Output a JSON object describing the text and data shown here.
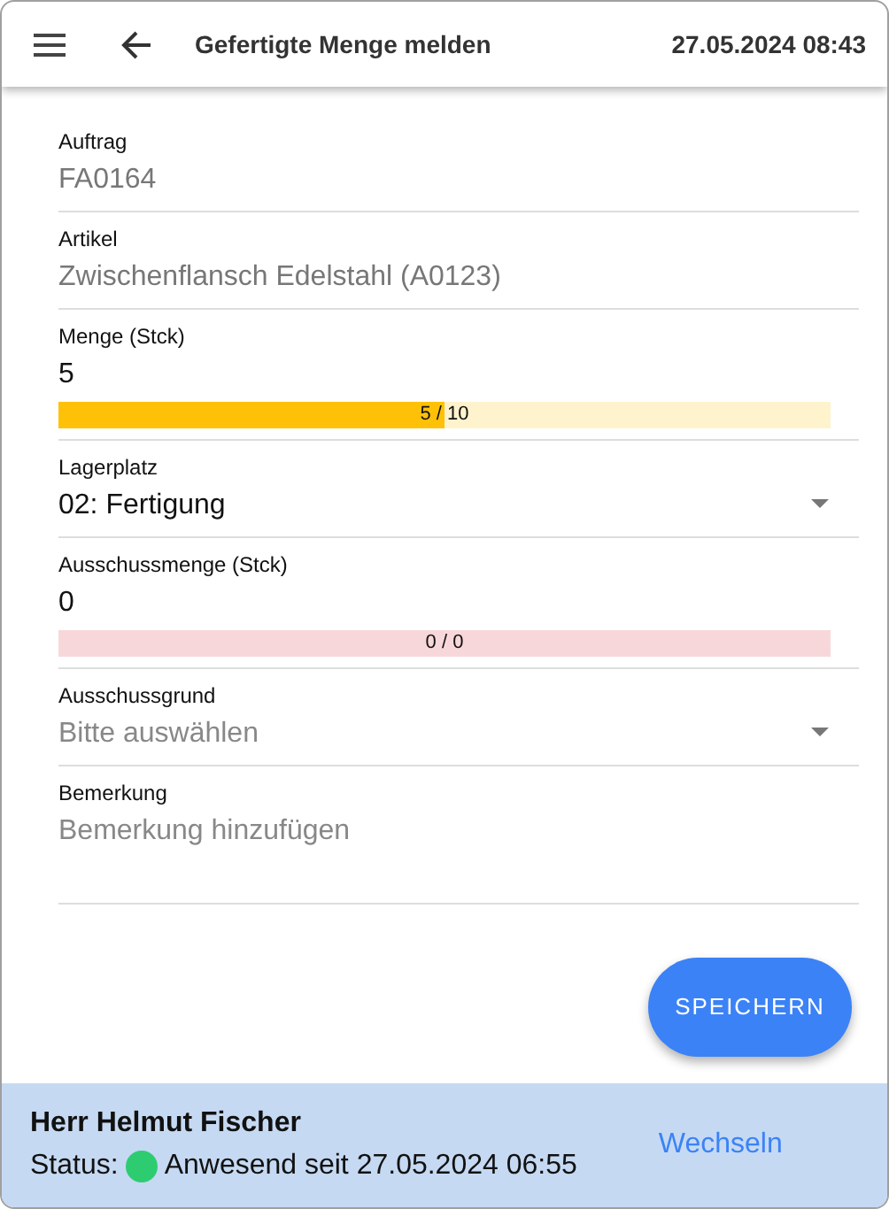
{
  "header": {
    "title": "Gefertigte Menge melden",
    "datetime": "27.05.2024 08:43"
  },
  "fields": [
    {
      "kind": "text",
      "label": "Auftrag",
      "value": "FA0164",
      "readonly": true
    },
    {
      "kind": "text",
      "label": "Artikel",
      "value": "Zwischenflansch Edelstahl (A0123)",
      "readonly": true
    },
    {
      "kind": "quantity",
      "label": "Menge (Stck)",
      "value": "5",
      "readonly": false,
      "level": 0.5,
      "reading": "5 / 10",
      "color": "#ffc107"
    },
    {
      "kind": "select",
      "label": "Lagerplatz",
      "value": "02: Fertigung",
      "readonly": false
    },
    {
      "kind": "quantity",
      "label": "Ausschussmenge (Stck)",
      "value": "0",
      "readonly": false,
      "level": 0,
      "reading": "0 / 0",
      "color": "#f8d7da"
    },
    {
      "kind": "select",
      "label": "Ausschussgrund",
      "placeholder": "Bitte auswählen",
      "readonly": false
    },
    {
      "kind": "textarea",
      "label": "Bemerkung",
      "placeholder": "Bemerkung hinzufügen",
      "readonly": false
    }
  ],
  "save_button": "SPEICHERN",
  "footer": {
    "name": "Herr Helmut Fischer",
    "status_label": "Status:",
    "status_text": "Anwesend seit 27.05.2024 06:55",
    "switch_link": "Wechseln"
  }
}
